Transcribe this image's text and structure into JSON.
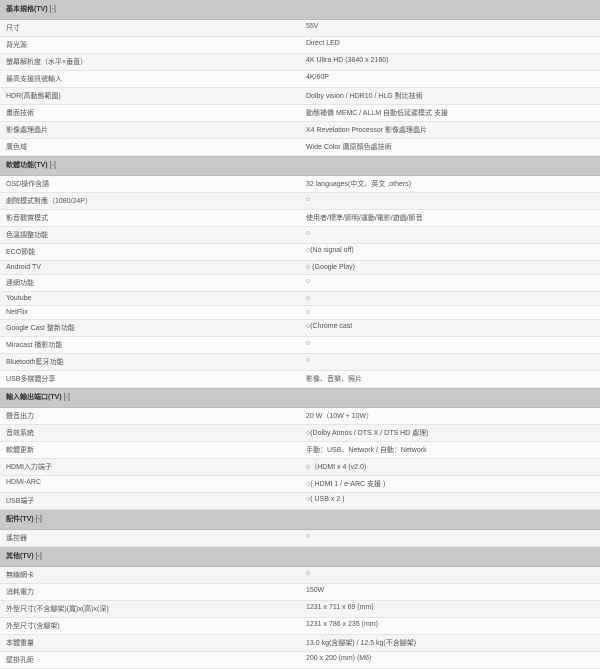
{
  "toggle": "[-]",
  "sections": [
    {
      "title": "基本規格(TV)",
      "rows": [
        {
          "l": "尺寸",
          "r": "55V"
        },
        {
          "l": "背光源",
          "r": "Direct LED"
        },
        {
          "l": "螢幕解析度（水平×垂直）",
          "r": "4K Ultra HD (3840 x 2160)"
        },
        {
          "l": "最高支援訊號輸入",
          "r": "4K/60P"
        },
        {
          "l": "HDR(高動態範圍)",
          "r": "Dolby vision / HDR10 / HLG 對比技術"
        },
        {
          "l": "畫面技術",
          "r": "動態補償 MEMC / ALLM 自動低延遲模式 支援"
        },
        {
          "l": "影像處理晶片",
          "r": "X4 Revelation Processor 影像處理晶片"
        },
        {
          "l": "廣色域",
          "r": "Wide Color 廣原顏色處技術"
        }
      ]
    },
    {
      "title": "軟體功能(TV)",
      "rows": [
        {
          "l": "OSD操作含語",
          "r": "32 languages(中文、英文 ,others)"
        },
        {
          "l": "劇院模式對應（1080/24P）",
          "r": "○"
        },
        {
          "l": "影音觀賞模式",
          "r": "使用者/標準/節明/運動/電影/遊戲/節音"
        },
        {
          "l": "色溫調整功能",
          "r": "○"
        },
        {
          "l": "ECO節能",
          "r": "○(No signal off)"
        },
        {
          "l": "Android TV",
          "r": "○ (Google Play)"
        },
        {
          "l": "連網功能",
          "r": "○"
        },
        {
          "l": "Youtube",
          "r": "○"
        },
        {
          "l": "NetFlix",
          "r": "○"
        },
        {
          "l": "Google Cast 整新功能",
          "r": "○(Chrome cast"
        },
        {
          "l": "Miracast 播影功能",
          "r": "○"
        },
        {
          "l": "Bluetooth藍牙功能",
          "r": "○"
        },
        {
          "l": "USB多媒體分享",
          "r": "影像、音樂、照片"
        }
      ]
    },
    {
      "title": "輸入輸出端口(TV)",
      "rows": [
        {
          "l": "聲音出力",
          "r": "20 W（10W + 10W）"
        },
        {
          "l": "音效系統",
          "r": "○(Dolby Atmos / DTS X / DTS HD 處理)"
        },
        {
          "l": "軟體更新",
          "r": "手動：USB、Network / 自動：Network"
        },
        {
          "l": "HDMI入力端子",
          "r": "○（HDMI x 4 (v2.0)"
        },
        {
          "l": "HDMI-ARC",
          "r": "○( HDMI 1 / e-ARC 支援 )"
        },
        {
          "l": "USB端子",
          "r": "○( USB x 2 )"
        }
      ]
    },
    {
      "title": "配件(TV)",
      "rows": [
        {
          "l": "遙控器",
          "r": "○"
        }
      ]
    },
    {
      "title": "其他(TV)",
      "rows": [
        {
          "l": "無線網卡",
          "r": "○"
        },
        {
          "l": "消耗電力",
          "r": "150W"
        },
        {
          "l": "外型尺寸(不含腳架)(寬)x(高)x(深)",
          "r": "1231 x 711 x 69 (mm)"
        },
        {
          "l": "外型尺寸(含腳架)",
          "r": "1231 x 786 x 235 (mm)"
        },
        {
          "l": "本體重量",
          "r": "13.0 kg(含腳架) / 12.5 kg(不含腳架)"
        },
        {
          "l": "壁掛孔距",
          "r": "200 x 200 (mm) (M6)"
        }
      ]
    }
  ]
}
